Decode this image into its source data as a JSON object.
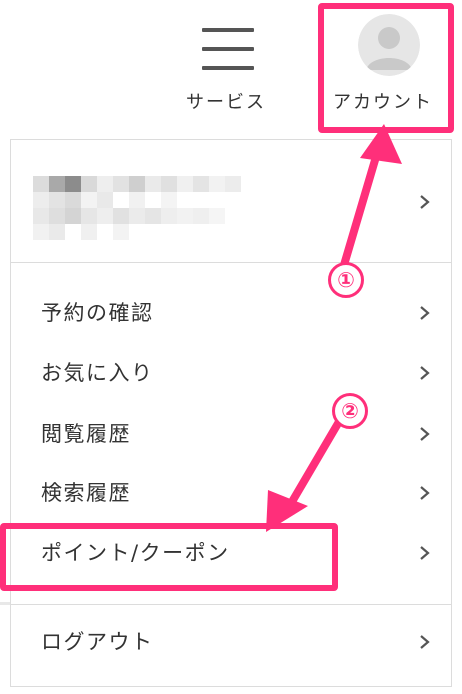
{
  "header": {
    "service_label": "サービス",
    "account_label": "アカウント"
  },
  "menu": {
    "items": [
      {
        "label": "予約の確認"
      },
      {
        "label": "お気に入り"
      },
      {
        "label": "閲覧履歴"
      },
      {
        "label": "検索履歴"
      },
      {
        "label": "ポイント/クーポン"
      },
      {
        "label": "ログアウト"
      }
    ]
  },
  "annotations": {
    "step1": "①",
    "step2": "②"
  },
  "colors": {
    "highlight": "#ff2f7a",
    "text": "#333333",
    "divider": "#dcdcdc"
  },
  "icons": {
    "menu": "hamburger-icon",
    "account": "user-avatar-icon",
    "chevron": "chevron-right-icon"
  }
}
